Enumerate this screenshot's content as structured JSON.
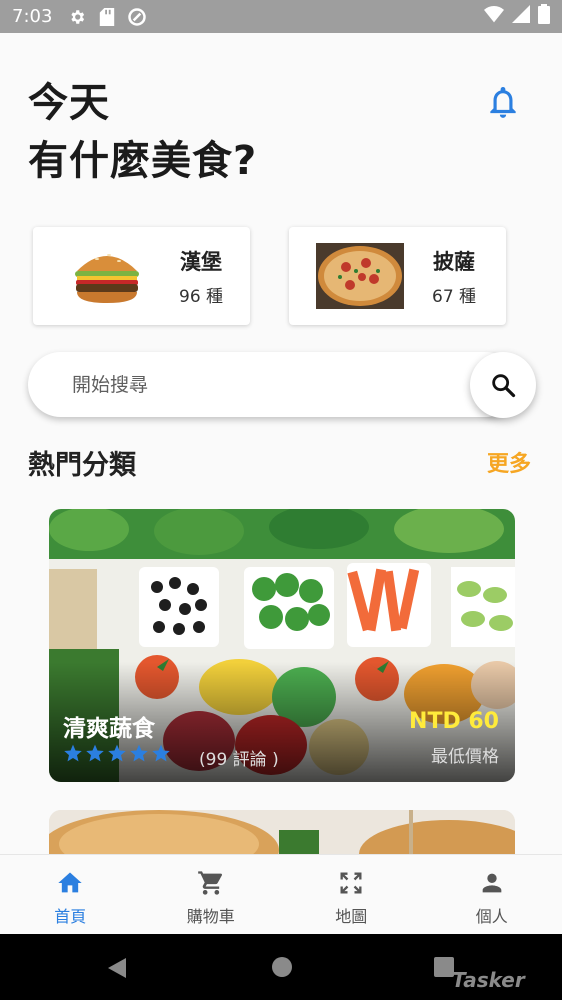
{
  "status_bar": {
    "time": "7:03"
  },
  "header": {
    "greeting_line1": "今天",
    "greeting_line2": "有什麼美食?"
  },
  "categories": [
    {
      "name": "漢堡",
      "count": "96 種"
    },
    {
      "name": "披薩",
      "count": "67 種"
    }
  ],
  "search": {
    "placeholder": "開始搜尋"
  },
  "section": {
    "title": "熱門分類",
    "more": "更多"
  },
  "featured": {
    "name": "清爽蔬食",
    "rating": 5,
    "reviews": "(99 評論 )",
    "price": "NTD 60",
    "price_label": "最低價格"
  },
  "bottom_nav": [
    {
      "label": "首頁",
      "icon": "home-icon",
      "active": true
    },
    {
      "label": "購物車",
      "icon": "cart-icon",
      "active": false
    },
    {
      "label": "地圖",
      "icon": "fullscreen-icon",
      "active": false
    },
    {
      "label": "個人",
      "icon": "person-icon",
      "active": false
    }
  ],
  "watermark": "Tasker",
  "colors": {
    "accent": "#2b7fe0",
    "more": "#f6a623",
    "price": "#ffeb3b",
    "status_bar": "#9e9e9e"
  }
}
